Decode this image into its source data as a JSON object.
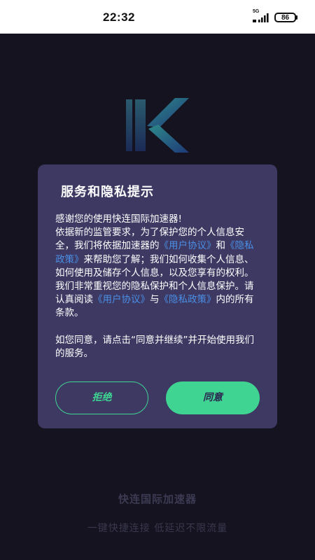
{
  "status_bar": {
    "time": "22:32",
    "network": "5G",
    "battery": "86"
  },
  "dialog": {
    "title": "服务和隐私提示",
    "body": {
      "p1": "感谢您的使用快连国际加速器!",
      "p2_a": "依据新的监管要求，为了保护您的个人信息安全，我们将依据加速器的",
      "user_agreement": "《用户协议》",
      "p2_b": "和",
      "privacy_policy": "《隐私政策》",
      "p2_c": "来帮助您了解；我们如何收集个人信息、如何使用及储存个人信息，以及您享有的权利。 我们非常重视您的隐私保护和个人信息保护。请认真阅读",
      "user_agreement_2": "《用户协议》",
      "p2_d": "与",
      "privacy_policy_2": "《隐私政策》",
      "p2_e": "内的所有条款。",
      "p3": "如您同意，请点击“同意并继续”并开始使用我们的服务。"
    },
    "reject_label": "拒绝",
    "agree_label": "同意"
  },
  "footer": {
    "app_name": "快连国际加速器",
    "slogan": "一键快捷连接 低延迟不限流量"
  },
  "colors": {
    "background": "#15131f",
    "dialog": "#3d3963",
    "accent": "#3fd492",
    "link": "#4a8fe6"
  }
}
